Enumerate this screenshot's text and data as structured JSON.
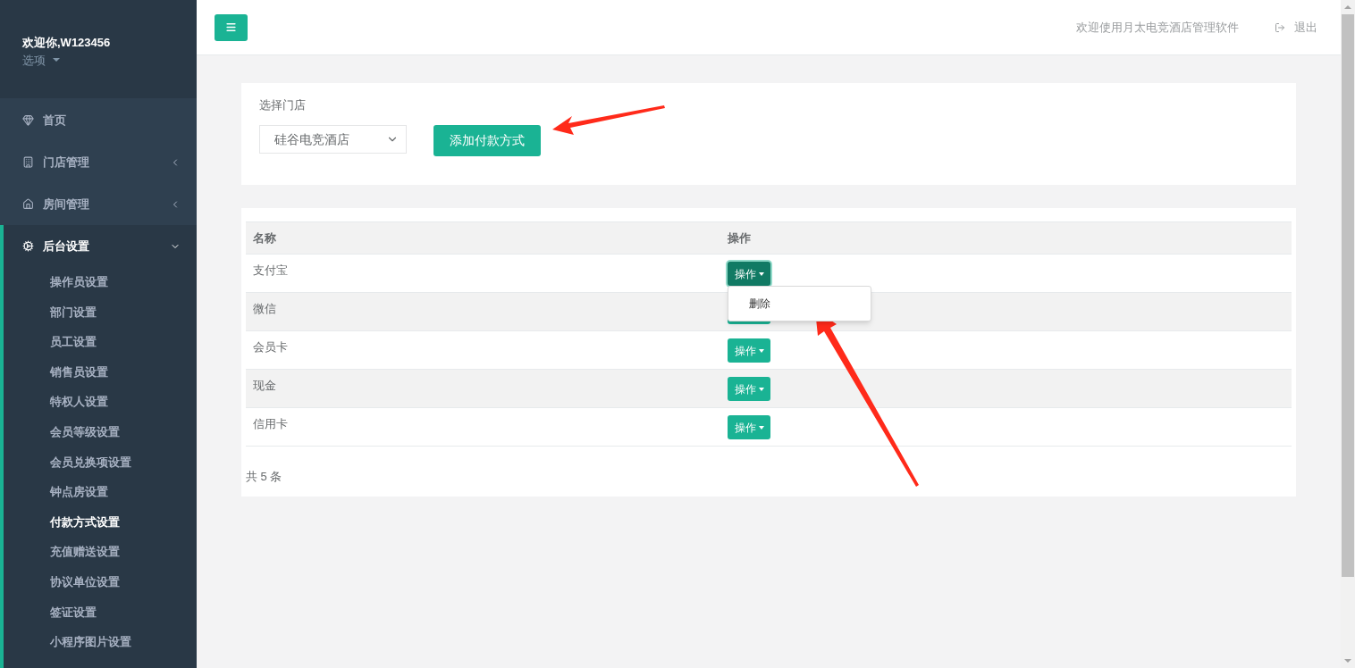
{
  "user": {
    "greeting": "欢迎你,W123456",
    "options_label": "选项"
  },
  "nav": [
    {
      "label": "首页",
      "kind": "link",
      "selected": false
    },
    {
      "label": "门店管理",
      "kind": "group",
      "expanded": false,
      "selected": false
    },
    {
      "label": "房间管理",
      "kind": "group",
      "expanded": false,
      "selected": false
    },
    {
      "label": "后台设置",
      "kind": "group",
      "expanded": true,
      "selected": true,
      "children": [
        {
          "label": "操作员设置",
          "selected": false
        },
        {
          "label": "部门设置",
          "selected": false
        },
        {
          "label": "员工设置",
          "selected": false
        },
        {
          "label": "销售员设置",
          "selected": false
        },
        {
          "label": "特权人设置",
          "selected": false
        },
        {
          "label": "会员等级设置",
          "selected": false
        },
        {
          "label": "会员兑换项设置",
          "selected": false
        },
        {
          "label": "钟点房设置",
          "selected": false
        },
        {
          "label": "付款方式设置",
          "selected": true
        },
        {
          "label": "充值赠送设置",
          "selected": false
        },
        {
          "label": "协议单位设置",
          "selected": false
        },
        {
          "label": "签证设置",
          "selected": false
        },
        {
          "label": "小程序图片设置",
          "selected": false
        }
      ]
    }
  ],
  "header": {
    "welcome": "欢迎使用月太电竞酒店管理软件",
    "logout": "退出"
  },
  "filter": {
    "label": "选择门店",
    "store_select": "硅谷电竞酒店",
    "add_button": "添加付款方式"
  },
  "table": {
    "columns": [
      "名称",
      "操作"
    ],
    "rows": [
      {
        "name": "支付宝",
        "action": "操作",
        "menu_open": true
      },
      {
        "name": "微信",
        "menu_open": false
      },
      {
        "name": "会员卡",
        "action": "操作",
        "menu_open": false
      },
      {
        "name": "现金",
        "action": "操作",
        "menu_open": false
      },
      {
        "name": "信用卡",
        "action": "操作",
        "menu_open": false
      }
    ],
    "menu_items": [
      "删除"
    ],
    "footer": "共 5 条"
  }
}
